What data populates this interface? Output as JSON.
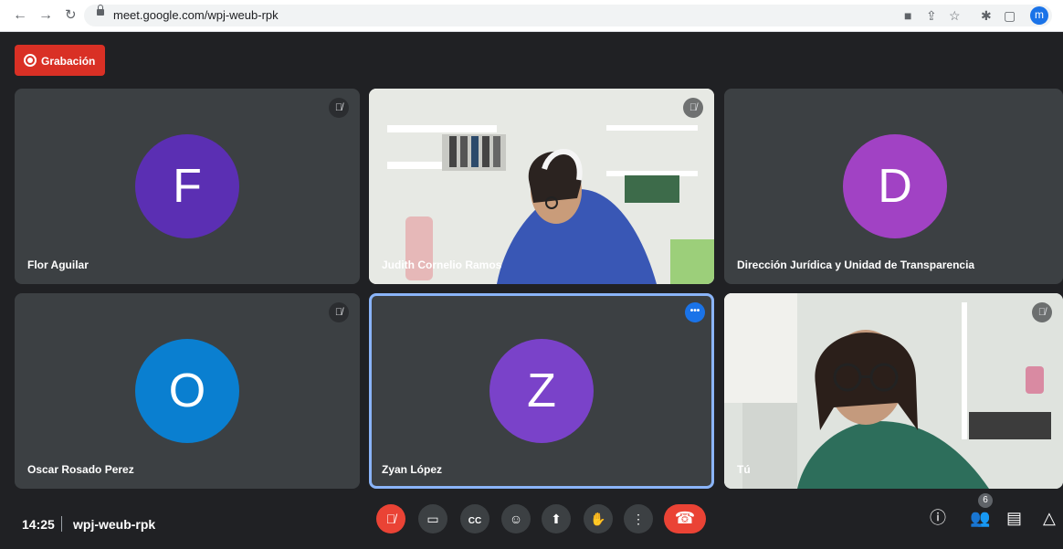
{
  "browser": {
    "url": "meet.google.com/wpj-weub-rpk",
    "avatar_letter": "m",
    "icons": [
      "back-icon",
      "forward-icon",
      "reload-icon",
      "camera-icon",
      "share-icon",
      "star-icon",
      "extensions-icon",
      "side-panel-icon"
    ]
  },
  "recording": {
    "label": "Grabación"
  },
  "tiles": [
    {
      "name": "Flor Aguilar",
      "initial": "F",
      "color": "#5b2fb3"
    },
    {
      "name": "Judith Cornelio Ramos"
    },
    {
      "name": "Dirección Jurídica y Unidad de Transparencia",
      "initial": "D",
      "color": "#a142c4"
    },
    {
      "name": "Oscar Rosado Perez",
      "initial": "O",
      "color": "#0a7fd0"
    },
    {
      "name": "Zyan López",
      "initial": "Z",
      "color": "#7a42c9"
    },
    {
      "name": "Tú"
    }
  ],
  "bottom": {
    "time": "14:25",
    "meeting_code": "wpj-weub-rpk",
    "participants_count": "6"
  },
  "colors": {
    "accent": "#1a73e8",
    "danger": "#ea4335",
    "tile_bg": "#3c4043",
    "app_bg": "#202124"
  }
}
